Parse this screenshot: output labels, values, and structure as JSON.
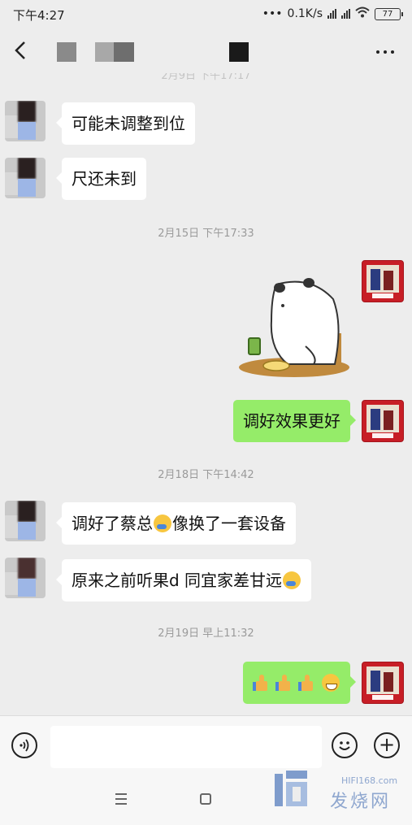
{
  "status_bar": {
    "time": "下午4:27",
    "network_speed": "0.1K/s",
    "battery": "77",
    "icons": [
      "dots-icon",
      "signal-icon",
      "signal-icon",
      "wifi-icon",
      "battery-icon"
    ]
  },
  "nav": {
    "back_icon": "chevron-left-icon",
    "more_icon": "more-dots-icon"
  },
  "messages": [
    {
      "type": "incoming",
      "text": "可能未调整到位"
    },
    {
      "type": "incoming",
      "text": "尺还未到"
    },
    {
      "type": "timestamp",
      "text": "2月15日 下午17:33"
    },
    {
      "type": "outgoing-sticker",
      "sticker": "bear-tea-sticker"
    },
    {
      "type": "outgoing",
      "text": "调好效果更好"
    },
    {
      "type": "timestamp",
      "text": "2月18日 下午14:42"
    },
    {
      "type": "incoming",
      "text_before": "调好了蔡总",
      "emoji": "crying-laugh-emoji",
      "text_after": "像换了一套设备"
    },
    {
      "type": "incoming",
      "text_before": "原来之前听果d 同宜家差甘远",
      "emoji": "crying-laugh-emoji",
      "text_after": ""
    },
    {
      "type": "timestamp",
      "text": "2月19日 早上11:32"
    },
    {
      "type": "outgoing",
      "emojis": [
        "thumbs-up-emoji",
        "thumbs-up-emoji",
        "thumbs-up-emoji",
        "grin-emoji"
      ]
    }
  ],
  "input_bar": {
    "value": "",
    "voice_icon": "voice-icon",
    "emoji_icon": "smiley-icon",
    "plus_icon": "plus-icon"
  },
  "system_nav": {
    "icons": [
      "menu-icon",
      "home-icon",
      "back-triangle-icon"
    ]
  },
  "watermark": {
    "url": "HIFI168.com",
    "name": "发烧网"
  },
  "colors": {
    "background": "#ededed",
    "incoming_bubble": "#ffffff",
    "outgoing_bubble": "#95ec69",
    "timestamp_text": "#9a9a9a"
  }
}
